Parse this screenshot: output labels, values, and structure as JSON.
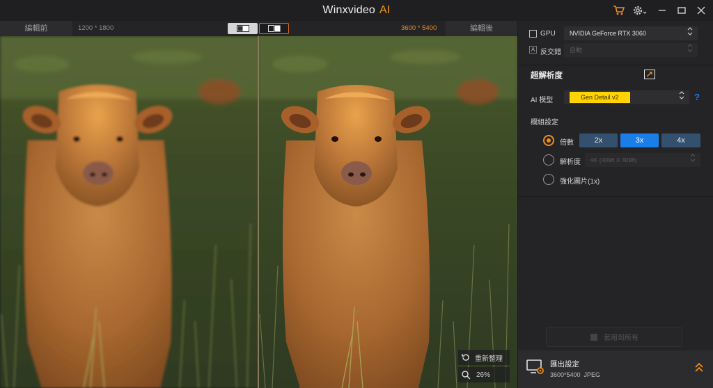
{
  "titlebar": {
    "app_name": "Winxvideo",
    "app_suffix": "AI",
    "icons": [
      "cart-icon",
      "gear-icon",
      "minimize-icon",
      "maximize-icon",
      "close-icon"
    ]
  },
  "compare": {
    "before_tab": "編輯前",
    "before_resolution": "1200 * 1800",
    "after_resolution": "3600 * 5400",
    "after_tab": "編輯後"
  },
  "preview": {
    "reset_label": "重新整理",
    "zoom_label": "26%"
  },
  "panel": {
    "gpu_label": "GPU",
    "gpu_value": "NVIDIA GeForce RTX 3060",
    "deint_label": "反交錯",
    "deint_value": "自動",
    "section_title": "超解析度",
    "ai_model_label": "AI 模型",
    "ai_model_value": "Gen Detail v2",
    "help_label": "?",
    "module_label": "欄組設定",
    "scale_label": "倍數",
    "scale_options": [
      "2x",
      "3x",
      "4x"
    ],
    "scale_selected": "3x",
    "resolution_label": "解析度",
    "resolution_value": "4K (4096 X 4096)",
    "enhance_label": "強化圖片(1x)",
    "apply_all_label": "套用到所有",
    "export_title": "匯出設定",
    "export_detail": "3600*5400  JPEG"
  },
  "colors": {
    "accent": "#f08c1e",
    "active_blue": "#1b7de8",
    "model_yellow": "#ffd400"
  }
}
